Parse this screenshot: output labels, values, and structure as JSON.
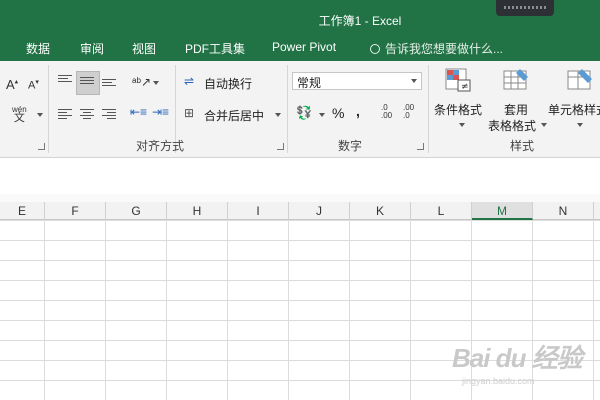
{
  "window": {
    "title": "工作簿1 - Excel"
  },
  "tabs": [
    "数据",
    "审阅",
    "视图",
    "PDF工具集",
    "Power Pivot"
  ],
  "tell_me": "告诉我您想要做什么...",
  "ribbon": {
    "font_group": {
      "grow_label": "A",
      "shrink_label": "A",
      "phonetic_top": "wén",
      "phonetic_main": "文"
    },
    "alignment_group": {
      "wrap_text": "自动换行",
      "merge_center": "合并后居中",
      "label": "对齐方式"
    },
    "number_group": {
      "format_value": "常规",
      "percent": "%",
      "comma": ",",
      "inc_decimal": ".0 .00",
      "dec_decimal": ".00 .0",
      "label": "数字"
    },
    "styles_group": {
      "conditional_format": "条件格式",
      "format_table_line1": "套用",
      "format_table_line2": "表格格式",
      "cell_styles": "单元格样式",
      "label": "样式"
    }
  },
  "sheet": {
    "columns": [
      "E",
      "F",
      "G",
      "H",
      "I",
      "J",
      "K",
      "L",
      "M",
      "N"
    ],
    "selected_column": "M"
  },
  "watermark": {
    "text": "Bai du 经验",
    "subtext": "jingyan.baidu.com"
  },
  "colors": {
    "accent": "#217346"
  }
}
